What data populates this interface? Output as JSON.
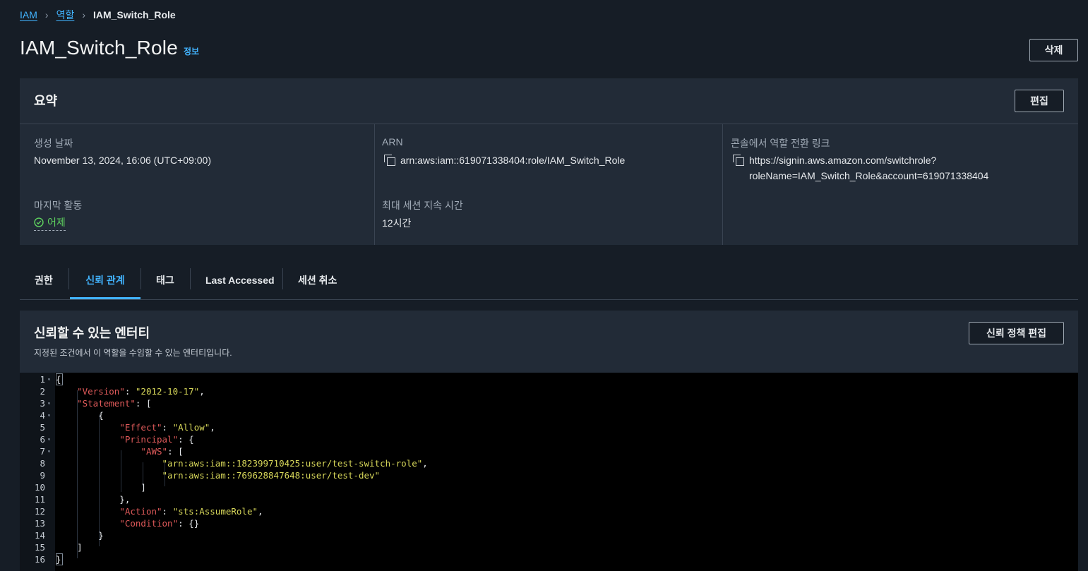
{
  "breadcrumb": {
    "items": [
      "IAM",
      "역할"
    ],
    "current": "IAM_Switch_Role"
  },
  "page": {
    "title": "IAM_Switch_Role",
    "info_link": "정보",
    "delete_label": "삭제"
  },
  "summary": {
    "title": "요약",
    "edit_label": "편집",
    "creation_date_label": "생성 날짜",
    "creation_date_value": "November 13, 2024, 16:06 (UTC+09:00)",
    "last_activity_label": "마지막 활동",
    "last_activity_value": "어제",
    "arn_label": "ARN",
    "arn_value": "arn:aws:iam::619071338404:role/IAM_Switch_Role",
    "max_session_label": "최대 세션 지속 시간",
    "max_session_value": "12시간",
    "switch_link_label": "콘솔에서 역할 전환 링크",
    "switch_link_line1": "https://signin.aws.amazon.com/switchrole?",
    "switch_link_line2": "roleName=IAM_Switch_Role&account=619071338404"
  },
  "tabs": [
    {
      "label": "권한",
      "active": false
    },
    {
      "label": "신뢰 관계",
      "active": true
    },
    {
      "label": "태그",
      "active": false
    },
    {
      "label": "Last Accessed",
      "active": false
    },
    {
      "label": "세션 취소",
      "active": false
    }
  ],
  "trusted": {
    "title": "신뢰할 수 있는 엔터티",
    "description": "지정된 조건에서 이 역할을 수임할 수 있는 엔터티입니다.",
    "edit_policy_label": "신뢰 정책 편집"
  },
  "policy_lines": [
    {
      "n": "1",
      "fold": true,
      "t": "{"
    },
    {
      "n": "2",
      "fold": false,
      "t": "    \"Version\": \"2012-10-17\","
    },
    {
      "n": "3",
      "fold": true,
      "t": "    \"Statement\": ["
    },
    {
      "n": "4",
      "fold": true,
      "t": "        {"
    },
    {
      "n": "5",
      "fold": false,
      "t": "            \"Effect\": \"Allow\","
    },
    {
      "n": "6",
      "fold": true,
      "t": "            \"Principal\": {"
    },
    {
      "n": "7",
      "fold": true,
      "t": "                \"AWS\": ["
    },
    {
      "n": "8",
      "fold": false,
      "t": "                    \"arn:aws:iam::182399710425:user/test-switch-role\","
    },
    {
      "n": "9",
      "fold": false,
      "t": "                    \"arn:aws:iam::769628847648:user/test-dev\""
    },
    {
      "n": "10",
      "fold": false,
      "t": "                ]"
    },
    {
      "n": "11",
      "fold": false,
      "t": "            },"
    },
    {
      "n": "12",
      "fold": false,
      "t": "            \"Action\": \"sts:AssumeRole\","
    },
    {
      "n": "13",
      "fold": false,
      "t": "            \"Condition\": {}"
    },
    {
      "n": "14",
      "fold": false,
      "t": "        }"
    },
    {
      "n": "15",
      "fold": false,
      "t": "    ]"
    },
    {
      "n": "16",
      "fold": false,
      "t": "}"
    }
  ],
  "colors": {
    "background": "#161d26",
    "panel": "#222b37",
    "accent": "#42b4ff",
    "success": "#5fd45f",
    "json_key": "#e05a5a",
    "json_string": "#d8d85a"
  }
}
